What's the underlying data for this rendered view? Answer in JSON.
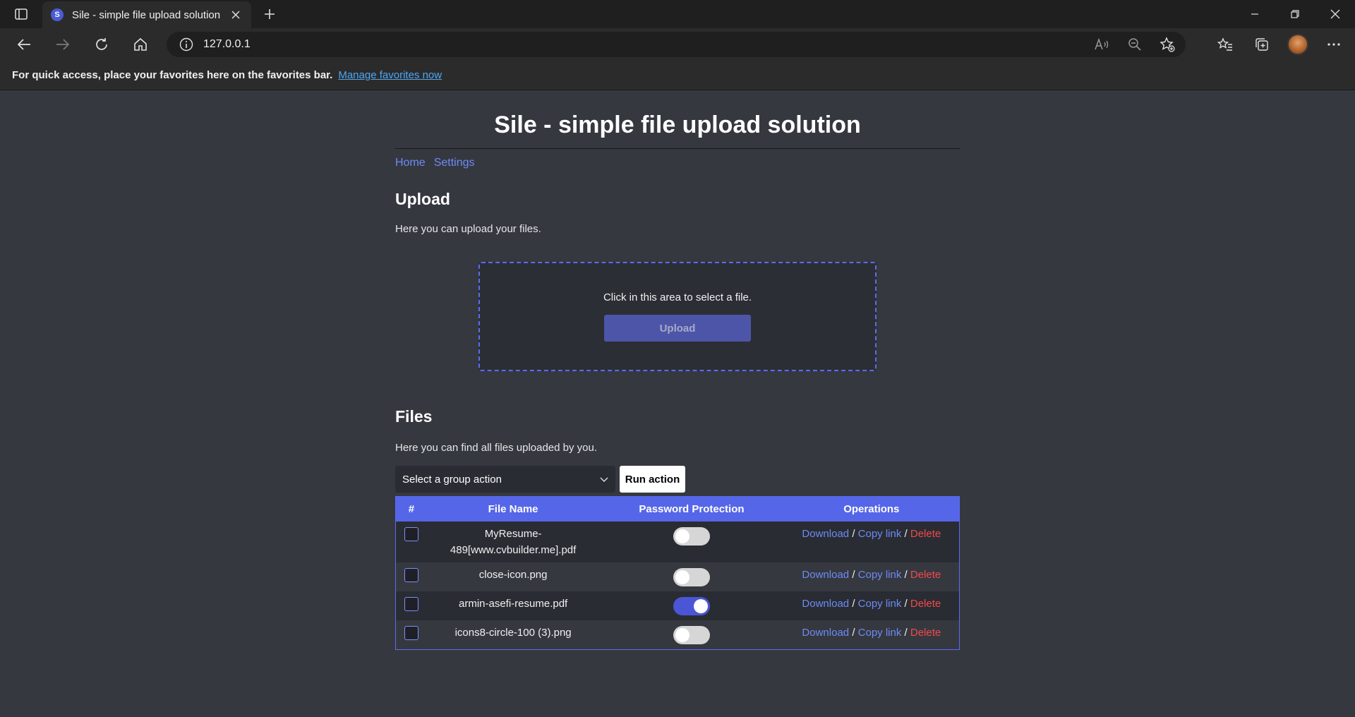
{
  "browser": {
    "tab_title": "Sile - simple file upload solution",
    "favicon_letter": "S",
    "url": "127.0.0.1",
    "favorites_bar_text": "For quick access, place your favorites here on the favorites bar.",
    "favorites_bar_link": "Manage favorites now"
  },
  "page": {
    "title": "Sile - simple file upload solution",
    "menu": [
      "Home",
      "Settings"
    ]
  },
  "upload": {
    "heading": "Upload",
    "description": "Here you can upload your files.",
    "dropzone_text": "Click in this area to select a file.",
    "button_label": "Upload"
  },
  "files": {
    "heading": "Files",
    "description": "Here you can find all files uploaded by you.",
    "group_action_selected": "Select a group action",
    "run_action_label": "Run action",
    "columns": [
      "#",
      "File Name",
      "Password Protection",
      "Operations"
    ],
    "op_labels": {
      "download": "Download",
      "copy": "Copy link",
      "delete": "Delete",
      "sep": "/"
    },
    "rows": [
      {
        "name": "MyResume-489[www.cvbuilder.me].pdf",
        "password_protected": false
      },
      {
        "name": "close-icon.png",
        "password_protected": false
      },
      {
        "name": "armin-asefi-resume.pdf",
        "password_protected": true
      },
      {
        "name": "icons8-circle-100 (3).png",
        "password_protected": false
      }
    ]
  },
  "colors": {
    "accent": "#5566e8",
    "link": "#6c8bf5",
    "danger": "#f24a4a",
    "background": "#363840"
  }
}
